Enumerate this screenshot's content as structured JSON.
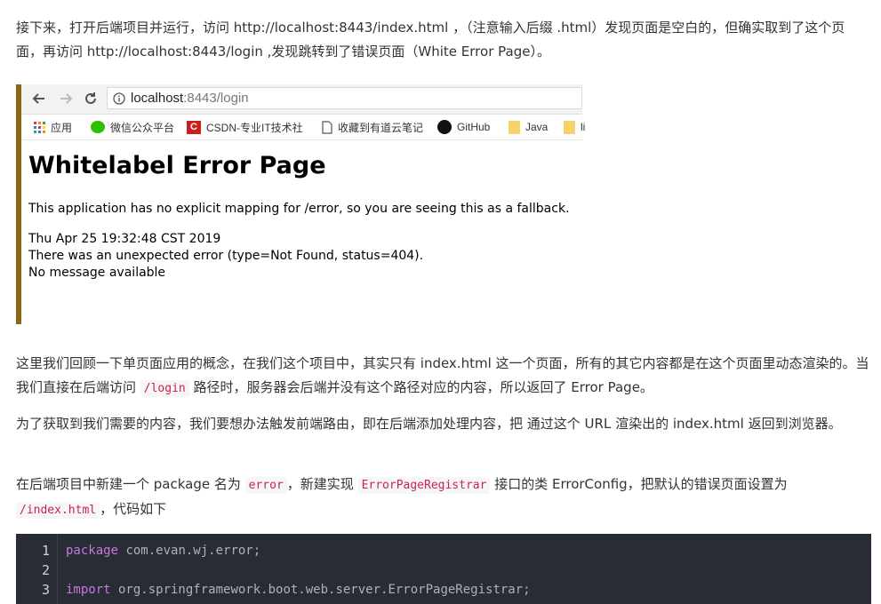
{
  "article": {
    "p1": "接下来，打开后端项目并运行，访问 http://localhost:8443/index.html ，（注意输入后缀 .html）发现页面是空白的，但确实取到了这个页面，再访问 http://localhost:8443/login ,发现跳转到了错误页面（White Error Page）。",
    "p2_before": "这里我们回顾一下单页面应用的概念，在我们这个项目中，其实只有 index.html 这一个页面，所有的其它内容都是在这个页面里动态渲染的。当我们直接在后端访问 ",
    "p2_code": "/login",
    "p2_after": " 路径时，服务器会后端并没有这个路径对应的内容，所以返回了 Error Page。",
    "p3": "为了获取到我们需要的内容，我们要想办法触发前端路由，即在后端添加处理内容，把 通过这个 URL 渲染出的 index.html 返回到浏览器。",
    "p4_a": "在后端项目中新建一个 package 名为 ",
    "p4_code1": "error",
    "p4_b": "，新建实现 ",
    "p4_code2": "ErrorPageRegistrar",
    "p4_c": " 接口的类 ErrorConfig，把默认的错误页面设置为 ",
    "p4_code3": "/index.html",
    "p4_d": "，代码如下"
  },
  "screenshot": {
    "url_host": "localhost",
    "url_path": ":8443/login",
    "bookmarks": [
      {
        "label": "应用",
        "icon": "apps-grid-icon"
      },
      {
        "label": "微信公众平台",
        "icon": "wechat-icon"
      },
      {
        "label": "CSDN-专业IT技术社",
        "icon": "csdn-icon"
      },
      {
        "label": "收藏到有道云笔记",
        "icon": "page-icon"
      },
      {
        "label": "GitHub",
        "icon": "github-icon"
      },
      {
        "label": "Java",
        "icon": "folder-icon"
      },
      {
        "label": "li",
        "icon": "folder-icon"
      }
    ],
    "error_title": "Whitelabel Error Page",
    "error_msg": "This application has no explicit mapping for /error, so you are seeing this as a fallback.",
    "error_time": "Thu Apr 25 19:32:48 CST 2019",
    "error_detail": "There was an unexpected error (type=Not Found, status=404).",
    "error_nomsg": "No message available",
    "colors": {
      "border": "#8b6914",
      "toolbar": "#f2f2f2"
    }
  },
  "code": {
    "lines": [
      {
        "num": "1",
        "kw": "package",
        "rest": " com.evan.wj.error;"
      },
      {
        "num": "2",
        "kw": "",
        "rest": ""
      },
      {
        "num": "3",
        "kw": "import",
        "rest": " org.springframework.boot.web.server.ErrorPageRegistrar;"
      }
    ],
    "colors": {
      "bg": "#282c34",
      "keyword": "#c678dd"
    }
  }
}
